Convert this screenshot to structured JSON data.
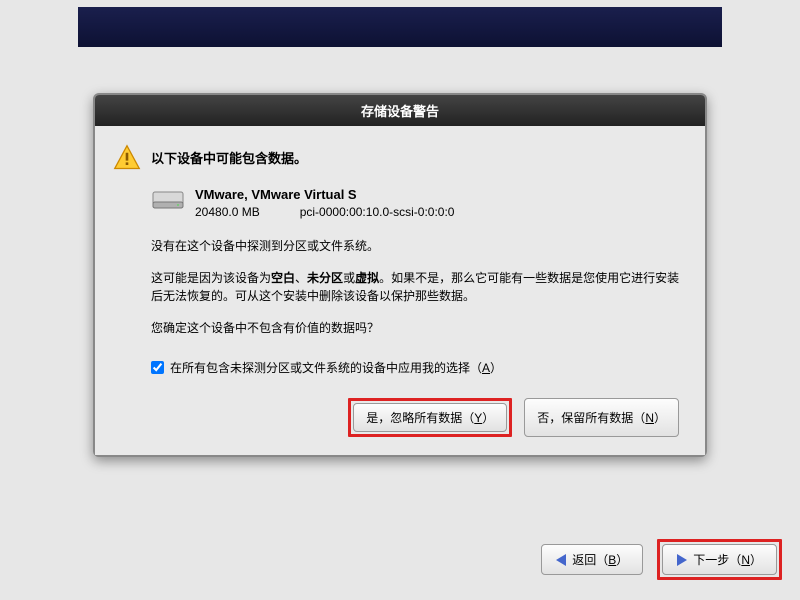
{
  "dialog": {
    "title": "存储设备警告",
    "header": "以下设备中可能包含数据。",
    "device": {
      "name": "VMware, VMware Virtual S",
      "size": "20480.0 MB",
      "path": "pci-0000:00:10.0-scsi-0:0:0:0"
    },
    "para1": "没有在这个设备中探测到分区或文件系统。",
    "para2_a": "这可能是因为该设备为",
    "para2_blank": "空白",
    "para2_sep1": "、",
    "para2_unpart": "未分区",
    "para2_sep2": "或",
    "para2_virtual": "虚拟",
    "para2_b": "。如果不是，那么它可能有一些数据是您使用它进行安装后无法恢复的。可从这个安装中删除该设备以保护那些数据。",
    "para3": "您确定这个设备中不包含有价值的数据吗？",
    "checkbox_label_a": "在所有包含未探测分区或文件系统的设备中应用我的选择（",
    "checkbox_key": "A",
    "checkbox_label_b": "）",
    "btn_yes_a": "是，忽略所有数据（",
    "btn_yes_key": "Y",
    "btn_yes_b": "）",
    "btn_no_a": "否，保留所有数据（",
    "btn_no_key": "N",
    "btn_no_b": "）"
  },
  "footer": {
    "back_a": "返回（",
    "back_key": "B",
    "back_b": "）",
    "next_a": "下一步（",
    "next_key": "N",
    "next_b": "）"
  }
}
